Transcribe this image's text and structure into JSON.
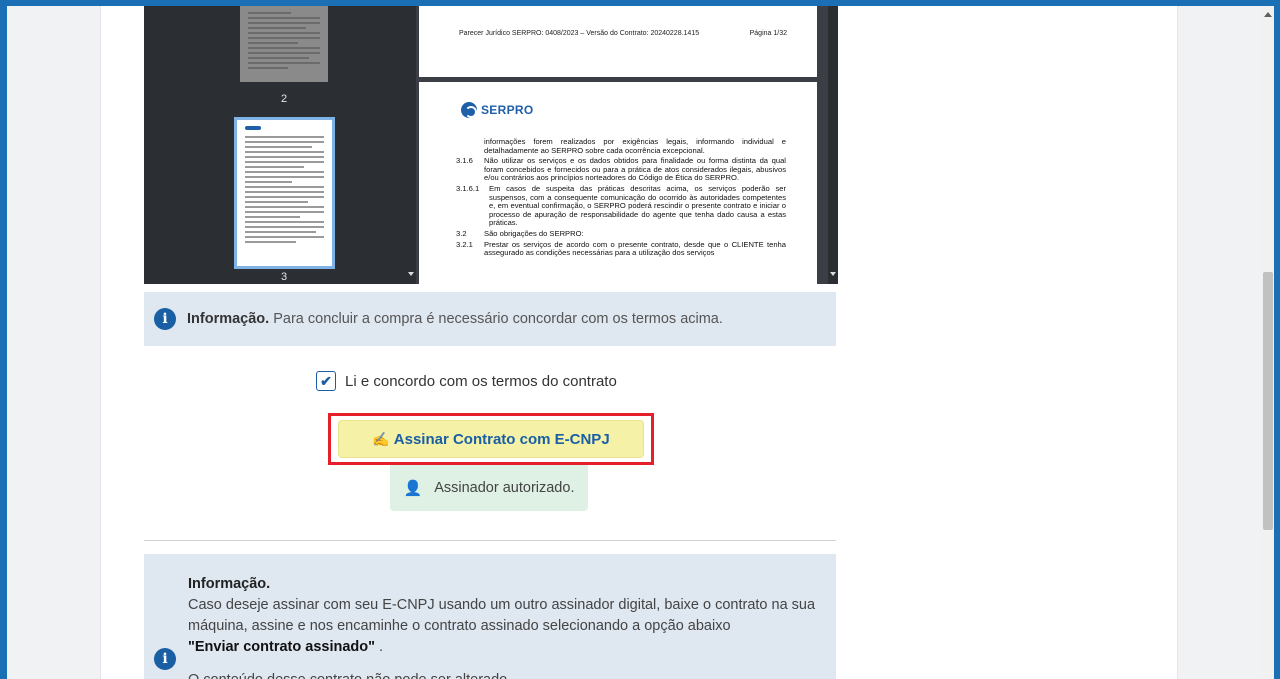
{
  "pdf": {
    "thumbnails": [
      {
        "page_number": "2"
      },
      {
        "page_number": "3"
      }
    ],
    "header_text": "Parecer Jurídico SERPRO: 0408/2023 – Versão do Contrato: 20240228.1415",
    "page_label": "Página 1/32",
    "logo_text": "SERPRO",
    "clauses": [
      {
        "num": "",
        "text": "informações forem realizados por exigências legais, informando individual e detalhadamente ao SERPRO sobre cada ocorrência excepcional."
      },
      {
        "num": "3.1.6",
        "text": "Não utilizar os serviços e os dados obtidos para finalidade ou forma distinta da qual foram concebidos e fornecidos ou para a prática de atos considerados ilegais, abusivos e/ou contrários aos princípios norteadores do Código de Ética do SERPRO."
      },
      {
        "num": "3.1.6.1",
        "text": "Em casos de suspeita das práticas descritas acima, os serviços poderão ser suspensos, com a consequente comunicação do ocorrido às autoridades competentes e, em eventual confirmação, o SERPRO poderá rescindir o presente contrato e iniciar o processo de apuração de responsabilidade do agente que tenha dado causa a estas práticas."
      },
      {
        "num": "3.2",
        "text": "São obrigações do SERPRO:"
      },
      {
        "num": "3.2.1",
        "text": "Prestar os serviços de acordo com o presente contrato, desde que o CLIENTE tenha assegurado as condições necessárias para a utilização dos serviços"
      }
    ]
  },
  "info_banner": {
    "title": "Informação.",
    "text": "Para concluir a compra é necessário concordar com os termos acima."
  },
  "agree": {
    "label": "Li e concordo com os termos do contrato",
    "checked": true
  },
  "sign_button": {
    "label": "Assinar Contrato com E-CNPJ"
  },
  "authorized": {
    "label": "Assinador autorizado."
  },
  "info_box": {
    "title": "Informação.",
    "text": "Caso deseje assinar com seu E-CNPJ usando um outro assinador digital, baixe o contrato na sua máquina, assine e nos encaminhe o contrato assinado selecionando a opção abaixo",
    "option": "\"Enviar contrato assinado\"",
    "option_suffix": " .",
    "note": "O conteúdo desse contrato não pode ser alterado."
  },
  "colors": {
    "frame_border": "#1b6fb5",
    "info_bg": "#dfe7f1",
    "sign_button_bg": "#f5f2a8",
    "highlight_border": "#e5202a",
    "authorized_bg": "#dff0e4"
  }
}
